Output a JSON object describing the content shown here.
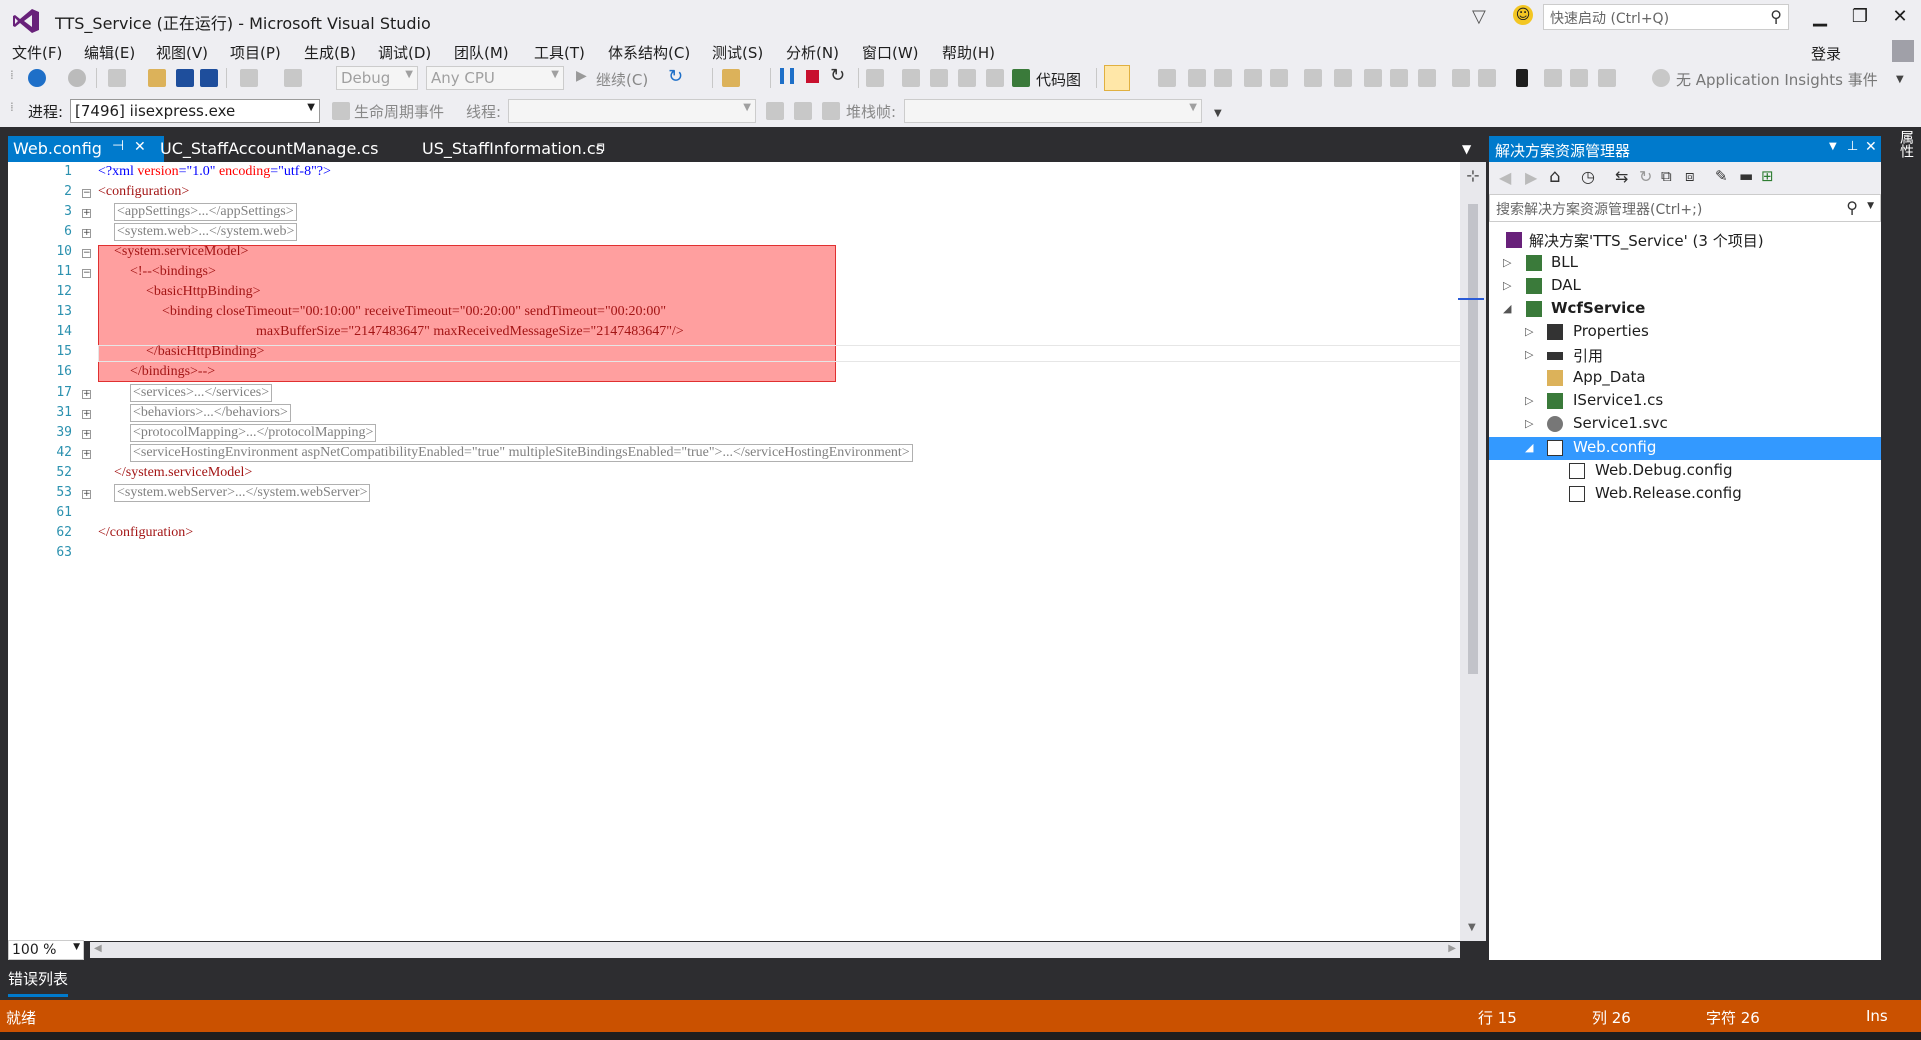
{
  "window": {
    "title": "TTS_Service (正在运行) - Microsoft Visual Studio",
    "quick_launch_placeholder": "快速启动 (Ctrl+Q)"
  },
  "menu": [
    "文件(F)",
    "编辑(E)",
    "视图(V)",
    "项目(P)",
    "生成(B)",
    "调试(D)",
    "团队(M)",
    "工具(T)",
    "体系结构(C)",
    "测试(S)",
    "分析(N)",
    "窗口(W)",
    "帮助(H)"
  ],
  "login_label": "登录",
  "toolbar": {
    "config": "Debug",
    "platform": "Any CPU",
    "continue_label": "继续(C)",
    "codemap_label": "代码图",
    "insights_label": "无 Application Insights 事件"
  },
  "debug_toolbar": {
    "process_label": "进程:",
    "process_value": "[7496] iisexpress.exe",
    "lifecycle_label": "生命周期事件",
    "thread_label": "线程:",
    "stackframe_label": "堆栈帧:"
  },
  "tabs": [
    {
      "label": "Web.config",
      "active": true
    },
    {
      "label": "UC_StaffAccountManage.cs",
      "active": false
    },
    {
      "label": "US_StaffInformation.cs",
      "active": false
    }
  ],
  "editor": {
    "line_numbers": [
      "1",
      "2",
      "3",
      "6",
      "10",
      "11",
      "12",
      "13",
      "14",
      "15",
      "16",
      "17",
      "31",
      "39",
      "42",
      "52",
      "53",
      "61",
      "62",
      "63"
    ],
    "lines": {
      "l1_tag": "<?xml ",
      "l1_a1": "version",
      "l1_v1": "=\"1.0\" ",
      "l1_a2": "encoding",
      "l1_v2": "=\"utf-8\"?>",
      "l2": "<configuration>",
      "l3": "<appSettings>...</appSettings>",
      "l6": "<system.web>...</system.web>",
      "l10": "<system.serviceModel>",
      "l11": "<!--<bindings>",
      "l12": "<basicHttpBinding>",
      "l13": "<binding closeTimeout=\"00:10:00\" receiveTimeout=\"00:20:00\" sendTimeout=\"00:20:00\"",
      "l14": "maxBufferSize=\"2147483647\" maxReceivedMessageSize=\"2147483647\"/>",
      "l15": "</basicHttpBinding>",
      "l16": "</bindings>-->",
      "l17": "<services>...</services>",
      "l31": "<behaviors>...</behaviors>",
      "l39": "<protocolMapping>...</protocolMapping>",
      "l42": "<serviceHostingEnvironment aspNetCompatibilityEnabled=\"true\" multipleSiteBindingsEnabled=\"true\">...</serviceHostingEnvironment>",
      "l52": "</system.serviceModel>",
      "l53": "<system.webServer>...</system.webServer>",
      "l62": "</configuration>"
    },
    "zoom": "100 %"
  },
  "solution_explorer": {
    "title": "解决方案资源管理器",
    "search_placeholder": "搜索解决方案资源管理器(Ctrl+;)",
    "items": [
      {
        "label": "解决方案'TTS_Service' (3 个项目)"
      },
      {
        "label": "BLL"
      },
      {
        "label": "DAL"
      },
      {
        "label": "WcfService"
      },
      {
        "label": "Properties"
      },
      {
        "label": "引用"
      },
      {
        "label": "App_Data"
      },
      {
        "label": "IService1.cs"
      },
      {
        "label": "Service1.svc"
      },
      {
        "label": "Web.config"
      },
      {
        "label": "Web.Debug.config"
      },
      {
        "label": "Web.Release.config"
      }
    ]
  },
  "side_tab_label": "属性",
  "error_list_label": "错误列表",
  "status": {
    "ready": "就绪",
    "line": "行 15",
    "col": "列 26",
    "char": "字符 26",
    "mode": "Ins"
  },
  "colors": {
    "accent": "#007acc",
    "status_bar": "#ca5100",
    "highlight": "#ff6b6b"
  }
}
